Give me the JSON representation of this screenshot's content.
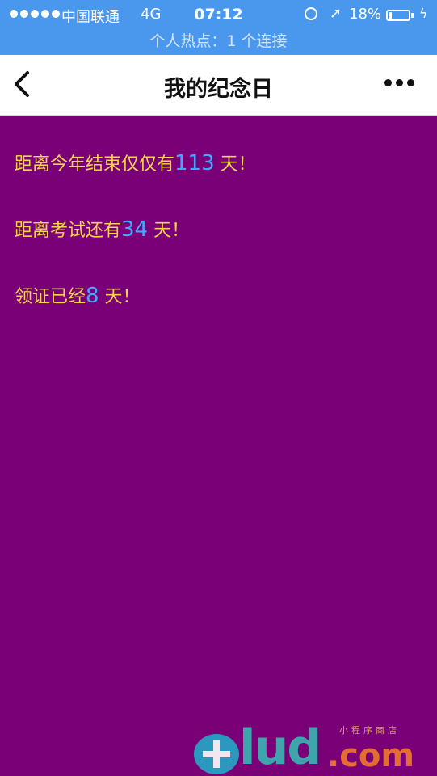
{
  "status_bar": {
    "carrier": "中国联通",
    "network": "4G",
    "time": "07:12",
    "battery_percent": "18%",
    "battery_level": 0.18,
    "hotspot": "个人热点：1 个连接"
  },
  "navbar": {
    "title": "我的纪念日",
    "back_icon": "chevron-left-icon",
    "more_icon": "more-dots-icon"
  },
  "items": [
    {
      "prefix": "距离今年结束仅仅有",
      "value": "113",
      "suffix": " 天！"
    },
    {
      "prefix": "距离考试还有",
      "value": "34",
      "suffix": " 天！"
    },
    {
      "prefix": "领证已经",
      "value": "8",
      "suffix": " 天！"
    }
  ],
  "watermark": {
    "brand": "lud",
    "tld": ".com",
    "tagline": "小程序商店"
  },
  "colors": {
    "statusbar_bg": "#4a98ee",
    "content_bg": "#7a0078",
    "text_yellow": "#f5d54a",
    "number_blue": "#42a9ff"
  }
}
